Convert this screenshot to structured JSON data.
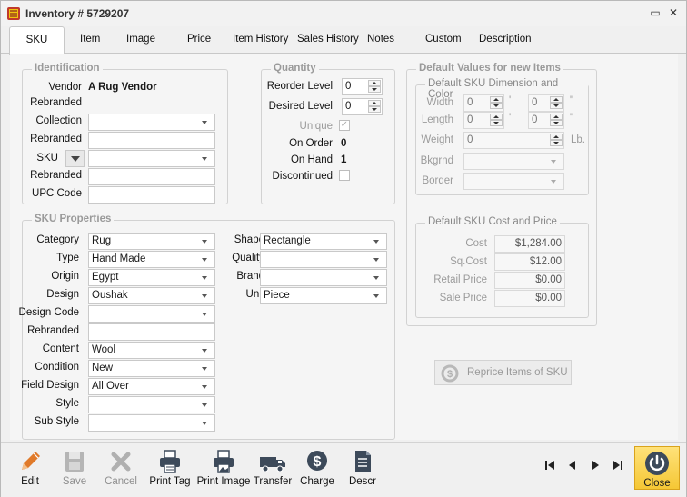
{
  "window": {
    "title": "Inventory # 5729207",
    "restore_glyph": "▭",
    "close_glyph": "✕"
  },
  "tabs": [
    "SKU",
    "Item",
    "Image",
    "Price",
    "Item History",
    "Sales History",
    "Notes",
    "Custom",
    "Description"
  ],
  "identification": {
    "title": "Identification",
    "vendor_label": "Vendor",
    "vendor_value": "A Rug Vendor",
    "rebranded1_label": "Rebranded",
    "collection_label": "Collection",
    "collection_value": "",
    "rebranded2_label": "Rebranded",
    "rebranded2_value": "",
    "sku_label": "SKU",
    "sku_value": "",
    "rebranded3_label": "Rebranded",
    "rebranded3_value": "",
    "upc_label": "UPC Code",
    "upc_value": ""
  },
  "quantity": {
    "title": "Quantity",
    "reorder_label": "Reorder Level",
    "reorder_value": "0",
    "desired_label": "Desired Level",
    "desired_value": "0",
    "unique_label": "Unique",
    "unique_checked": true,
    "onorder_label": "On Order",
    "onorder_value": "0",
    "onhand_label": "On Hand",
    "onhand_value": "1",
    "discontinued_label": "Discontinued",
    "discontinued_checked": false
  },
  "sku_properties": {
    "title": "SKU Properties",
    "left": [
      {
        "label": "Category",
        "value": "Rug"
      },
      {
        "label": "Type",
        "value": "Hand Made"
      },
      {
        "label": "Origin",
        "value": "Egypt"
      },
      {
        "label": "Design",
        "value": "Oushak"
      },
      {
        "label": "Design Code",
        "value": ""
      },
      {
        "label": "Rebranded",
        "value": ""
      },
      {
        "label": "Content",
        "value": "Wool"
      },
      {
        "label": "Condition",
        "value": "New"
      },
      {
        "label": "Field Design",
        "value": "All Over"
      },
      {
        "label": "Style",
        "value": ""
      },
      {
        "label": "Sub Style",
        "value": ""
      }
    ],
    "right": [
      {
        "label": "Shape",
        "value": "Rectangle"
      },
      {
        "label": "Quality",
        "value": ""
      },
      {
        "label": "Brand",
        "value": ""
      },
      {
        "label": "Unit",
        "value": "Piece"
      }
    ]
  },
  "defaults": {
    "title": "Default Values for new Items",
    "dimension_title": "Default SKU Dimension and Color",
    "width_label": "Width",
    "width_ft": "0",
    "width_in": "0",
    "length_label": "Length",
    "length_ft": "0",
    "length_in": "0",
    "feet_mark": "'",
    "inch_mark": "\"",
    "weight_label": "Weight",
    "weight_value": "0",
    "weight_unit": "Lb.",
    "bkgrnd_label": "Bkgrnd",
    "bkgrnd_value": "",
    "border_label": "Border",
    "border_value": "",
    "cost_title": "Default SKU Cost and Price",
    "cost_label": "Cost",
    "cost_value": "$1,284.00",
    "sqcost_label": "Sq.Cost",
    "sqcost_value": "$12.00",
    "retail_label": "Retail Price",
    "retail_value": "$0.00",
    "sale_label": "Sale Price",
    "sale_value": "$0.00"
  },
  "reprice_label": "Reprice Items of SKU",
  "toolbar": {
    "edit": "Edit",
    "save": "Save",
    "cancel": "Cancel",
    "print_tag": "Print Tag",
    "print_image": "Print Image",
    "transfer": "Transfer",
    "charge": "Charge",
    "descr": "Descr",
    "close": "Close"
  },
  "colors": {
    "accent": "#f5c735",
    "edit_icon": "#e07a2a",
    "icon_dark": "#3d4a5a",
    "disabled": "#9b9b9b"
  }
}
